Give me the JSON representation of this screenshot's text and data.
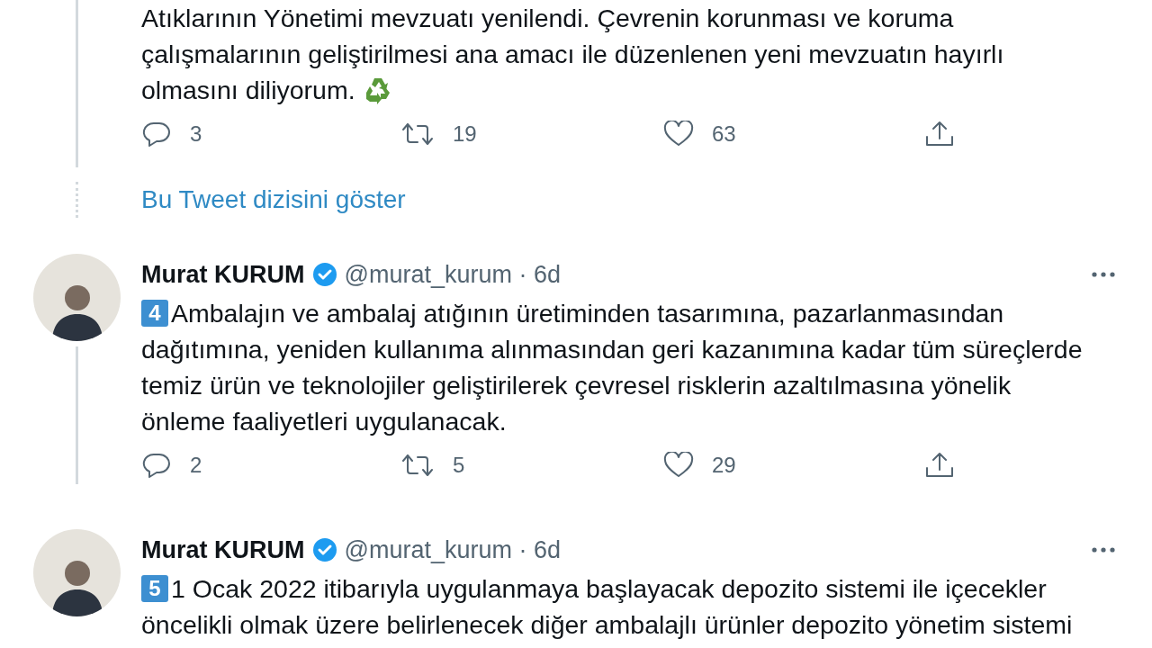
{
  "timeline": [
    {
      "kind": "continued",
      "text_lines": [
        "Atıklarının Yönetimi mevzuatı yenilendi. Çevrenin korunması ve koruma",
        "çalışmalarının geliştirilmesi ana amacı ile düzenlenen yeni mevzuatın hayırlı",
        "olmasını diliyorum."
      ],
      "ends_with_emoji": true,
      "actions": {
        "replies": "3",
        "retweets": "19",
        "likes": "63"
      }
    },
    {
      "kind": "thread_link",
      "label": "Bu Tweet dizisini göster"
    },
    {
      "kind": "tweet",
      "author": "Murat KURUM",
      "verified": true,
      "meta": "@murat_kurum · 6d",
      "number_badge": "4",
      "text_lines": [
        "Ambalajın ve ambalaj atığının üretiminden tasarımına, pazarlanmasından",
        "dağıtımına, yeniden kullanıma alınmasından geri kazanımına kadar tüm süreçlerde",
        "temiz ürün ve teknolojiler geliştirilerek çevresel risklerin azaltılmasına yönelik",
        "önleme faaliyetleri uygulanacak."
      ],
      "actions": {
        "replies": "2",
        "retweets": "5",
        "likes": "29"
      }
    },
    {
      "kind": "tweet",
      "author": "Murat KURUM",
      "verified": true,
      "meta": "@murat_kurum · 6d",
      "number_badge": "5",
      "text_lines": [
        "1 Ocak 2022 itibarıyla uygulanmaya başlayacak depozito sistemi ile içecekler",
        "öncelikli olmak üzere belirlenecek diğer ambalajlı ürünler depozito yönetim sistemi"
      ]
    }
  ]
}
